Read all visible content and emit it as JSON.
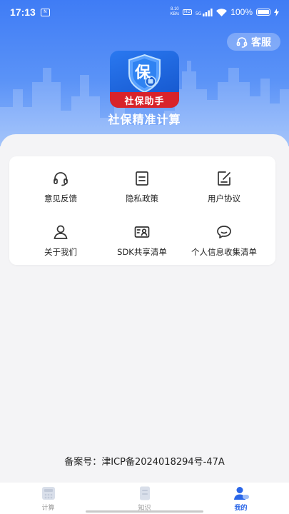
{
  "status_bar": {
    "time": "17:13",
    "app_badge": "N",
    "net_speed_value": "8.10",
    "net_speed_unit": "KB/s",
    "hd": "HD",
    "signal": "5G",
    "battery": "100%"
  },
  "header": {
    "service_label": "客服",
    "logo_badge": "保",
    "logo_banner": "社保助手",
    "app_title": "社保精准计算"
  },
  "menu": {
    "items": [
      {
        "label": "意见反馈",
        "icon": "headset-icon"
      },
      {
        "label": "隐私政策",
        "icon": "document-icon"
      },
      {
        "label": "用户协议",
        "icon": "edit-document-icon"
      },
      {
        "label": "关于我们",
        "icon": "user-icon"
      },
      {
        "label": "SDK共享清单",
        "icon": "id-card-icon"
      },
      {
        "label": "个人信息收集清单",
        "icon": "chat-bubble-icon"
      }
    ]
  },
  "record": "备案号：津ICP备2024018294号-47A",
  "tabbar": {
    "tabs": [
      {
        "label": "计算",
        "icon": "calculator-icon",
        "active": false
      },
      {
        "label": "知识",
        "icon": "book-icon",
        "active": false
      },
      {
        "label": "我的",
        "icon": "profile-icon",
        "active": true
      }
    ]
  },
  "colors": {
    "primary": "#3f7cf5",
    "active_tab": "#2a66e8",
    "logo_banner": "#d8232a"
  }
}
